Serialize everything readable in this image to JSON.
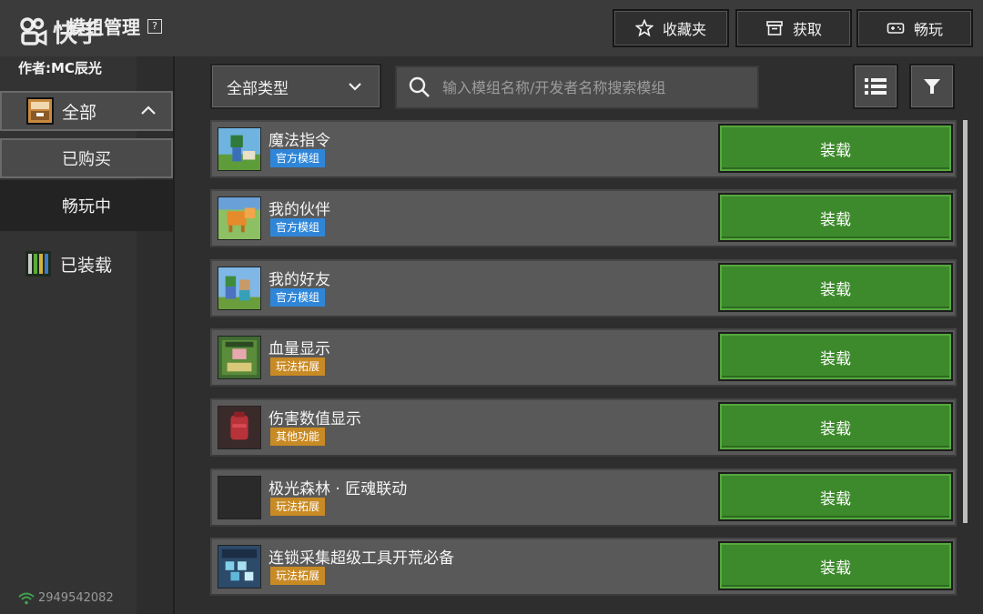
{
  "header": {
    "logo_text": "快手",
    "title": "模组管理",
    "help_symbol": "?",
    "author": "作者:MC辰光",
    "buttons": {
      "favorites": "收藏夹",
      "get": "获取",
      "play": "畅玩"
    }
  },
  "sidebar": {
    "all": "全部",
    "bought": "已购买",
    "playing": "畅玩中",
    "installed": "已装载",
    "network_id": "2949542082"
  },
  "toolbar": {
    "type_select": "全部类型",
    "search_placeholder": "输入模组名称/开发者名称搜索模组"
  },
  "mods": [
    {
      "name": "魔法指令",
      "tag": "官方模组",
      "tag_color": "#2f86d8",
      "action": "装载"
    },
    {
      "name": "我的伙伴",
      "tag": "官方模组",
      "tag_color": "#2f86d8",
      "action": "装载"
    },
    {
      "name": "我的好友",
      "tag": "官方模组",
      "tag_color": "#2f86d8",
      "action": "装载"
    },
    {
      "name": "血量显示",
      "tag": "玩法拓展",
      "tag_color": "#c88a24",
      "action": "装载"
    },
    {
      "name": "伤害数值显示",
      "tag": "其他功能",
      "tag_color": "#c88a24",
      "action": "装载"
    },
    {
      "name": "极光森林 · 匠魂联动",
      "tag": "玩法拓展",
      "tag_color": "#c88a24",
      "action": "装载"
    },
    {
      "name": "连锁采集超级工具开荒必备",
      "tag": "玩法拓展",
      "tag_color": "#c88a24",
      "action": "装载"
    }
  ],
  "colors": {
    "load_button": "#3d8a2c",
    "official_tag": "#2f86d8",
    "category_tag": "#c88a24"
  }
}
